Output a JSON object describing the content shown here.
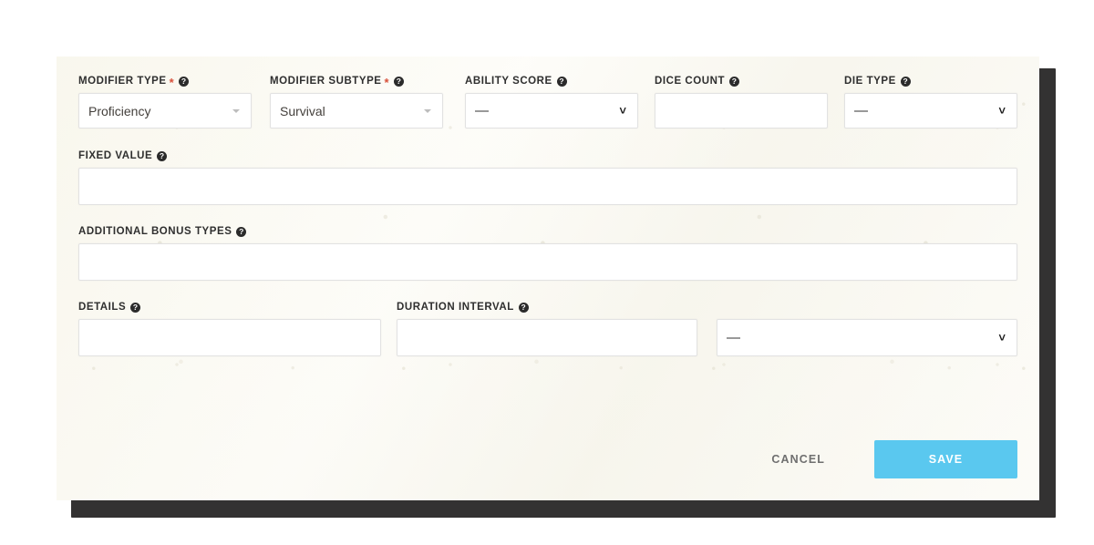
{
  "theme": {
    "panel_bg": "#faf9f2",
    "shadow": "#333232",
    "accent": "#5ac8ef",
    "required_marker": "#d8503a",
    "label_color": "#2f2f2f",
    "cancel_color": "#6f6f6f",
    "field_border": "#e2e2e2"
  },
  "form": {
    "rows": [
      {
        "fields": [
          {
            "label": "MODIFIER TYPE",
            "required": true,
            "required_marker": "*",
            "help": "?",
            "control": "select",
            "value": "Proficiency",
            "caret": "triangle-small"
          },
          {
            "label": "MODIFIER SUBTYPE",
            "required": true,
            "required_marker": "*",
            "help": "?",
            "control": "select",
            "value": "Survival",
            "caret": "triangle-small"
          },
          {
            "label": "ABILITY SCORE",
            "required": false,
            "required_marker": "",
            "help": "?",
            "control": "select",
            "value": "—",
            "caret": "chevron-down"
          },
          {
            "label": "DICE COUNT",
            "required": false,
            "required_marker": "",
            "help": "?",
            "control": "text",
            "value": "",
            "caret": ""
          },
          {
            "label": "DIE TYPE",
            "required": false,
            "required_marker": "",
            "help": "?",
            "control": "select",
            "value": "—",
            "caret": "chevron-down"
          }
        ]
      },
      {
        "fields": [
          {
            "label": "FIXED VALUE",
            "required": false,
            "required_marker": "",
            "help": "?",
            "control": "text",
            "value": "",
            "caret": ""
          }
        ]
      },
      {
        "fields": [
          {
            "label": "ADDITIONAL BONUS TYPES",
            "required": false,
            "required_marker": "",
            "help": "?",
            "control": "text",
            "value": "",
            "caret": ""
          }
        ]
      },
      {
        "fields": [
          {
            "label": "DETAILS",
            "required": false,
            "required_marker": "",
            "help": "?",
            "control": "text",
            "value": "",
            "caret": ""
          },
          {
            "label": "DURATION INTERVAL",
            "required": false,
            "required_marker": "",
            "help": "?",
            "control": "text",
            "value": "",
            "caret": ""
          },
          {
            "label": "",
            "required": false,
            "required_marker": "",
            "help": "",
            "control": "select",
            "value": "—",
            "caret": "chevron-down"
          }
        ]
      }
    ]
  },
  "footer": {
    "cancel_label": "Cancel",
    "save_label": "Save"
  },
  "icons": {
    "help": "help-circle-icon",
    "chevron": "˅"
  }
}
